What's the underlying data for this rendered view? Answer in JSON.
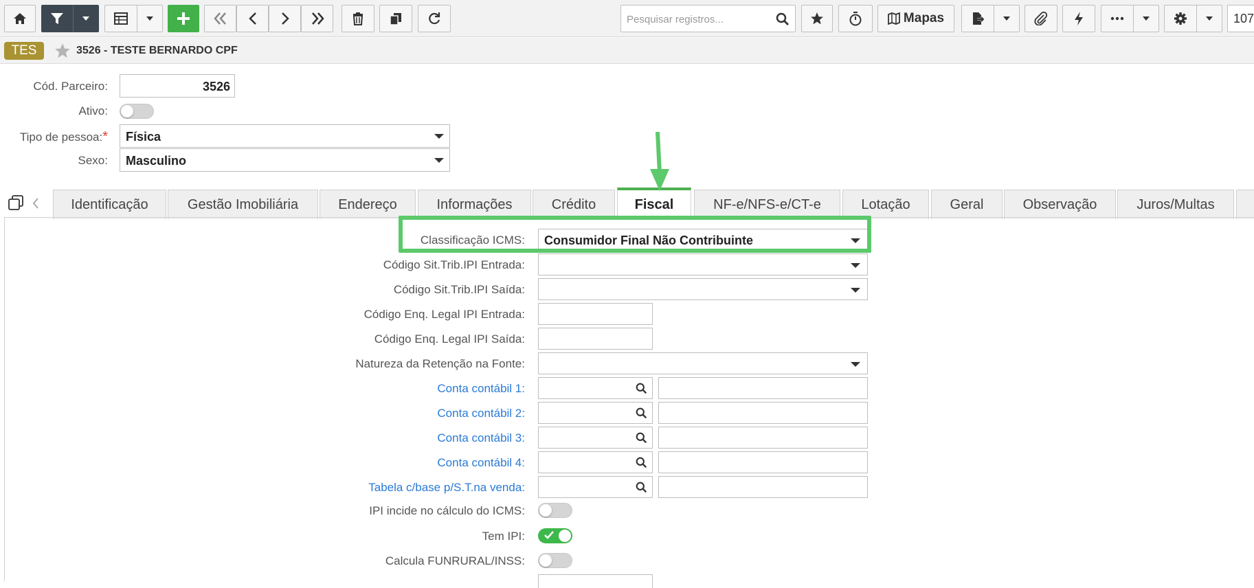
{
  "toolbar": {
    "search_placeholder": "Pesquisar registros...",
    "maps_label": "Mapas",
    "page_indicator": "107",
    "icons": [
      "home-icon",
      "filter-icon",
      "grid-icon",
      "add-icon",
      "first-icon",
      "previous-icon",
      "next-icon",
      "last-icon",
      "trash-icon",
      "copy-icon",
      "refresh-icon",
      "search-icon",
      "star-icon",
      "timer-icon",
      "map-icon",
      "export-icon",
      "paperclip-icon",
      "bolt-icon",
      "more-icon",
      "gear-icon"
    ]
  },
  "record": {
    "badge": "TES",
    "title": "3526 - TESTE BERNARDO CPF"
  },
  "header_form": {
    "cod_parceiro_label": "Cód. Parceiro:",
    "cod_parceiro_value": "3526",
    "ativo_label": "Ativo:",
    "ativo_on": false,
    "tipo_pessoa_label": "Tipo de pessoa:",
    "tipo_pessoa_value": "Física",
    "sexo_label": "Sexo:",
    "sexo_value": "Masculino"
  },
  "tabs": [
    {
      "label": "Identificação"
    },
    {
      "label": "Gestão Imobiliária"
    },
    {
      "label": "Endereço"
    },
    {
      "label": "Informações"
    },
    {
      "label": "Crédito"
    },
    {
      "label": "Fiscal",
      "active": true
    },
    {
      "label": "NF-e/NFS-e/CT-e"
    },
    {
      "label": "Lotação"
    },
    {
      "label": "Geral"
    },
    {
      "label": "Observação"
    },
    {
      "label": "Juros/Multas"
    }
  ],
  "fiscal": {
    "classificacao_icms_label": "Classificação ICMS:",
    "classificacao_icms_value": "Consumidor Final Não Contribuinte",
    "cst_ipi_entrada_label": "Código Sit.Trib.IPI Entrada:",
    "cst_ipi_saida_label": "Código Sit.Trib.IPI Saída:",
    "enq_ipi_entrada_label": "Código Enq. Legal IPI Entrada:",
    "enq_ipi_saida_label": "Código Enq. Legal IPI Saída:",
    "natureza_retencao_label": "Natureza da Retenção na Fonte:",
    "conta1_label": "Conta contábil 1:",
    "conta2_label": "Conta contábil 2:",
    "conta3_label": "Conta contábil 3:",
    "conta4_label": "Conta contábil 4:",
    "tabela_st_label": "Tabela c/base p/S.T.na venda:",
    "ipi_icms_label": "IPI incide no cálculo do ICMS:",
    "ipi_icms_on": false,
    "tem_ipi_label": "Tem IPI:",
    "tem_ipi_on": true,
    "funrural_label": "Calcula FUNRURAL/INSS:",
    "funrural_on": false
  },
  "colors": {
    "accent_green": "#43b14a",
    "highlight_green": "#5cc96a",
    "badge_gold": "#a99332",
    "link_blue": "#2a7ad6",
    "toolbar_dark": "#3d4751"
  }
}
